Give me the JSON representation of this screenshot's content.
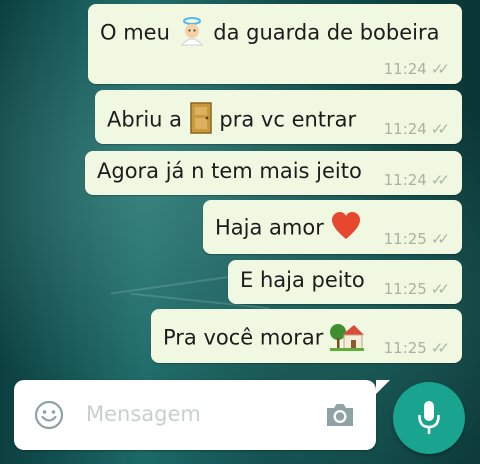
{
  "messages": [
    {
      "before": "O meu",
      "emoji": "angel-icon",
      "after": "da guarda de bobeira",
      "time": "11:24"
    },
    {
      "before": "Abriu a",
      "emoji": "door-icon",
      "after": "pra vc entrar",
      "time": "11:24"
    },
    {
      "before": "Agora já n tem mais jeito",
      "emoji": "",
      "after": "",
      "time": "11:24"
    },
    {
      "before": "Haja amor",
      "emoji": "heart-icon",
      "after": "",
      "time": "11:25"
    },
    {
      "before": "E haja peito",
      "emoji": "",
      "after": "",
      "time": "11:25"
    },
    {
      "before": "Pra você morar",
      "emoji": "house-with-garden-icon",
      "after": "",
      "time": "11:25"
    }
  ],
  "composer": {
    "placeholder": "Mensagem",
    "emoji_icon": "smiley-icon",
    "camera_icon": "camera-icon",
    "send_icon": "microphone-icon"
  },
  "colors": {
    "bubble": "#f1f8e2",
    "accent": "#19a48f",
    "ticks": "#a9b7a5"
  }
}
